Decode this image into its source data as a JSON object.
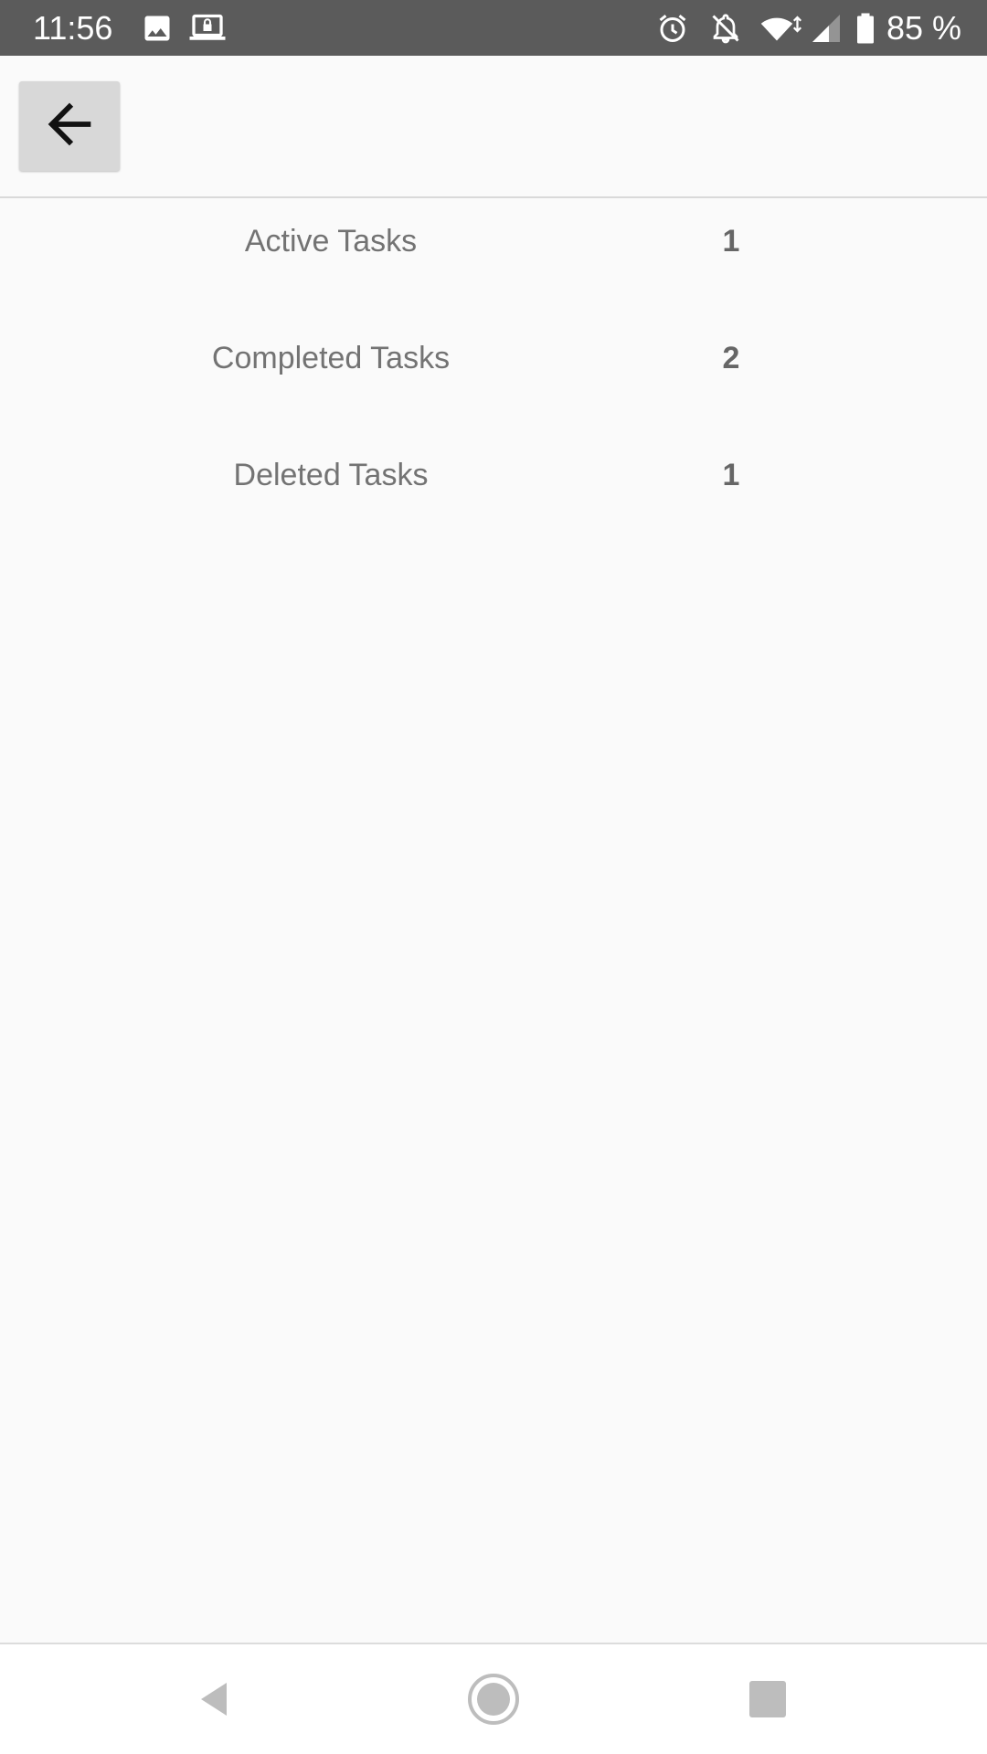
{
  "status_bar": {
    "time": "11:56",
    "battery": "85 %",
    "left_icons": [
      "image-icon",
      "laptop-lock-icon"
    ],
    "right_icons": [
      "alarm-icon",
      "notifications-off-icon",
      "wifi-icon",
      "signal-icon",
      "battery-icon"
    ]
  },
  "toolbar": {
    "back_icon": "arrow-back-icon"
  },
  "stats": [
    {
      "label": "Active Tasks",
      "value": "1"
    },
    {
      "label": "Completed Tasks",
      "value": "2"
    },
    {
      "label": "Deleted Tasks",
      "value": "1"
    }
  ],
  "nav_bar": {
    "icons": [
      "nav-back-icon",
      "nav-home-icon",
      "nav-recents-icon"
    ]
  },
  "colors": {
    "status_bar_bg": "#5b5b5b",
    "background": "#fafafa",
    "label_text": "#737373",
    "value_text": "#666666",
    "nav_icon": "#bdbdbd"
  }
}
